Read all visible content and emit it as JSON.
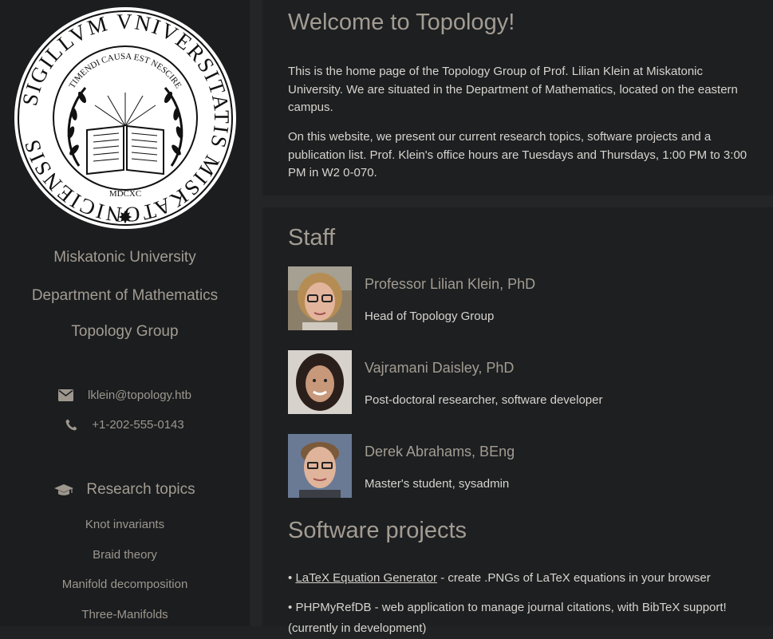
{
  "sidebar": {
    "seal": {
      "outer_text": "SIGILLVM VNIVERSITATIS MISKATONICIENSIS",
      "motto": "TIMENDI CAUSA EST NESCIRE",
      "year": "MDCXC"
    },
    "university": "Miskatonic University",
    "department": "Department of Mathematics",
    "group": "Topology Group",
    "email": "lklein@topology.htb",
    "email_icon": "envelope-icon",
    "phone": "+1-202-555-0143",
    "phone_icon": "phone-icon",
    "research_heading": "Research topics",
    "research_icon": "graduation-cap-icon",
    "topics": [
      "Knot invariants",
      "Braid theory",
      "Manifold decomposition",
      "Three-Manifolds"
    ]
  },
  "main": {
    "welcome_title": "Welcome to Topology!",
    "intro_1": "This is the home page of the Topology Group of Prof. Lilian Klein at Miskatonic University. We are situated in the Department of Mathematics, located on the eastern campus.",
    "intro_2": "On this website, we present our current research topics, software projects and a publication list. Prof. Klein's office hours are Tuesdays and Thursdays, 1:00 PM to 3:00 PM in W2 0-070.",
    "staff_title": "Staff",
    "staff": [
      {
        "name": "Professor Lilian Klein, PhD",
        "role": "Head of Topology Group"
      },
      {
        "name": "Vajramani Daisley, PhD",
        "role": "Post-doctoral researcher, software developer"
      },
      {
        "name": "Derek Abrahams, BEng",
        "role": "Master's student, sysadmin"
      }
    ],
    "software_title": "Software projects",
    "projects": [
      {
        "bullet": "•",
        "link": "LaTeX Equation Generator",
        "desc": " - create .PNGs of LaTeX equations in your browser"
      },
      {
        "bullet": "•",
        "name": "PHPMyRefDB",
        "desc": " - web application to manage journal citations, with BibTeX support! (currently in development)"
      }
    ]
  },
  "colors": {
    "background": "#202224",
    "sidebar": "#1b1d1f",
    "panel": "#1d1f21",
    "heading": "#a39c92",
    "text": "#d8d4ce"
  }
}
